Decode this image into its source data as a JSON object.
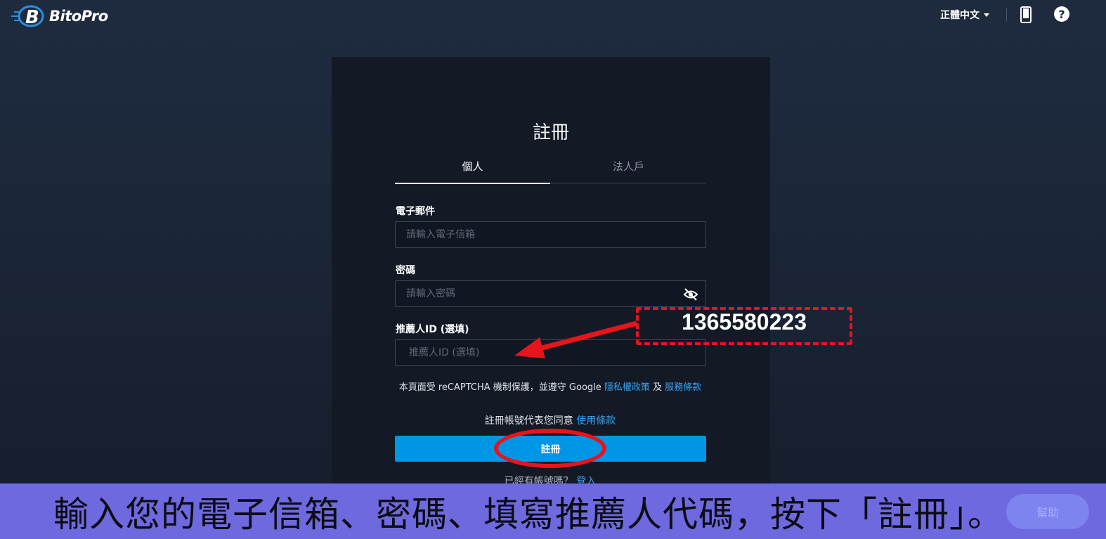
{
  "header": {
    "brand": "BitoPro",
    "language": "正體中文",
    "icons": [
      "phone-icon",
      "help-icon"
    ]
  },
  "form": {
    "title": "註冊",
    "tabs": [
      {
        "label": "個人",
        "active": true
      },
      {
        "label": "法人戶",
        "active": false
      }
    ],
    "email": {
      "label": "電子郵件",
      "placeholder": "請輸入電子信箱",
      "value": ""
    },
    "password": {
      "label": "密碼",
      "placeholder": "請輸入密碼",
      "value": ""
    },
    "referrer": {
      "label": "推薦人ID (選填)",
      "placeholder": "推薦人ID (選填)",
      "value": ""
    },
    "recaptcha_text": "本頁面受 reCAPTCHA 機制保護，並遵守 Google",
    "privacy_link": "隱私權政策",
    "and_text": "及",
    "terms_link": "服務條款",
    "agree_text": "註冊帳號代表您同意",
    "usage_link": "使用條款",
    "submit_label": "註冊",
    "login_prompt": "已經有帳號嗎？",
    "login_link": "登入"
  },
  "annotation": {
    "referral_code": "1365580223"
  },
  "caption": {
    "text": "輸入您的電子信箱、密碼、填寫推薦人代碼，按下「註冊」。",
    "help_label": "幫助"
  },
  "colors": {
    "background": "#1b2638",
    "card": "#131a26",
    "button": "#0096e6",
    "link": "#3aa0ee",
    "annotation": "#e8141b",
    "caption_bar": "#6e69de"
  }
}
